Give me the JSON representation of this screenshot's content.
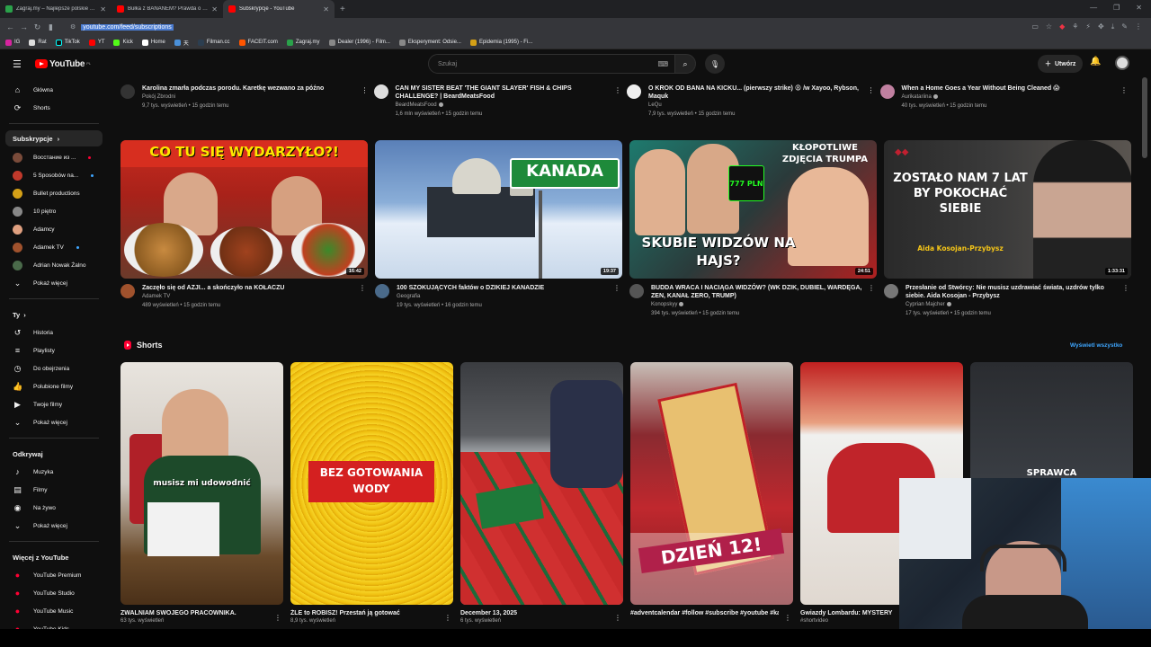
{
  "browser": {
    "tabs": [
      {
        "label": "Zagraj.my – Najlepsze polskie quizy",
        "color": "#2aa14a"
      },
      {
        "label": "Bułka z BANANEM? Prawda o Subsk",
        "color": "#ff0000"
      },
      {
        "label": "Subskrypcje - YouTube",
        "color": "#ff0000"
      }
    ],
    "new_tab": "+",
    "url": "youtube.com/feed/subscriptions",
    "bookmarks": [
      "IG",
      "Rat",
      "TikTok",
      "YT",
      "Kick",
      "Home",
      "天",
      "Filman.cc",
      "FACEIT.com",
      "Zagraj.my",
      "Dealer (1996) - Film...",
      "Eksperyment: Odsie...",
      "Epidemia (1995) - Fi..."
    ]
  },
  "header": {
    "logo": "YouTube",
    "country": "PL",
    "search_placeholder": "Szukaj",
    "create_label": "Utwórz"
  },
  "sidebar": {
    "main": [
      {
        "label": "Główna",
        "icon": "home-icon"
      },
      {
        "label": "Shorts",
        "icon": "shorts-icon"
      }
    ],
    "subs_header": "Subskrypcje",
    "channels": [
      {
        "label": "Восстание из ...",
        "color": "#7a4b3a",
        "live": true
      },
      {
        "label": "5 Sposobów na...",
        "color": "#c0392b",
        "live": false
      },
      {
        "label": "Bullet productions",
        "color": "#d4a017",
        "live": false
      },
      {
        "label": "10 piętro",
        "color": "#888888",
        "live": false
      },
      {
        "label": "Adamcy",
        "color": "#e0a080",
        "live": false
      },
      {
        "label": "Adamek TV",
        "color": "#a0522d",
        "live": true
      },
      {
        "label": "Adrian Nowak Żalno",
        "color": "#4a6a4a",
        "live": false
      }
    ],
    "show_more": "Pokaż więcej",
    "you_header": "Ty",
    "you": [
      {
        "label": "Historia",
        "icon": "history-icon"
      },
      {
        "label": "Playlisty",
        "icon": "playlist-icon"
      },
      {
        "label": "Do obejrzenia",
        "icon": "watch-later-icon"
      },
      {
        "label": "Polubione filmy",
        "icon": "like-icon"
      },
      {
        "label": "Twoje filmy",
        "icon": "your-videos-icon"
      }
    ],
    "explore_header": "Odkrywaj",
    "explore": [
      {
        "label": "Muzyka",
        "icon": "music-icon"
      },
      {
        "label": "Filmy",
        "icon": "film-icon"
      },
      {
        "label": "Na żywo",
        "icon": "live-icon"
      }
    ],
    "more_header": "Więcej z YouTube",
    "more": [
      {
        "label": "YouTube Premium"
      },
      {
        "label": "YouTube Studio"
      },
      {
        "label": "YouTube Music"
      },
      {
        "label": "YouTube Kids"
      }
    ]
  },
  "top_row": [
    {
      "title": "Karolina zmarła podczas porodu. Karetkę wezwano za późno",
      "channel": "Pokój Zbrodni",
      "stats": "9,7 tys. wyświetleń • 15 godzin temu",
      "ch_color": "#333333"
    },
    {
      "title": "CAN MY SISTER BEAT 'THE GIANT SLAYER' FISH & CHIPS CHALLENGE? | BeardMeatsFood",
      "channel": "BeardMeatsFood",
      "stats": "1,6 mln wyświetleń • 15 godzin temu",
      "ch_color": "#dddddd"
    },
    {
      "title": "O KROK OD BANA NA KICKU... (pierwszy strike) 😩 /w Xayoo, Rybson, Maquk",
      "channel": "LeQu",
      "stats": "7,9 tys. wyświetleń • 15 godzin temu",
      "ch_color": "#eeeeee"
    },
    {
      "title": "When a Home Goes a Year Without Being Cleaned 😱",
      "channel": "Aurikatariina",
      "stats": "40 tys. wyświetleń • 15 godzin temu",
      "ch_color": "#c080a0"
    }
  ],
  "videos": [
    {
      "title": "Zaczęło się od AZJI... a skończyło na KOŁACZU",
      "channel": "Adamek TV",
      "stats": "489 wyświetleń • 15 godzin temu",
      "duration": "16:42",
      "thumb_text": "CO TU SIĘ WYDARZYŁO?!",
      "ch_color": "#a0522d",
      "verified": false
    },
    {
      "title": "100 SZOKUJĄCYCH faktów o DZIKIEJ KANADZIE",
      "channel": "Geografia",
      "stats": "19 tys. wyświetleń • 16 godzin temu",
      "duration": "19:37",
      "thumb_text": "KANADA",
      "ch_color": "#4a6a8a",
      "verified": false
    },
    {
      "title": "BUDDA WRACA I NACIĄGA WIDZÓW? (WK DZIK, DUBIEL, WARDĘGA, ZEN, KANAŁ ZERO, TRUMP)",
      "channel": "Konopskyy",
      "stats": "394 tys. wyświetleń • 15 godzin temu",
      "duration": "24:51",
      "thumb_text": "SKUBIE WIDZÓW NA HAJS?",
      "thumb_top": "KŁOPOTLIWE ZDJĘCIA TRUMPA",
      "thumb_price": "777 PLN",
      "ch_color": "#555555",
      "verified": true
    },
    {
      "title": "Przesłanie od Stwórcy: Nie musisz uzdrawiać świata, uzdrów tylko siebie. Aida Kosojan - Przybysz",
      "channel": "Cyprian Majcher",
      "stats": "17 tys. wyświetleń • 15 godzin temu",
      "duration": "1:33:31",
      "thumb_text": "ZOSTAŁO NAM 7 LAT BY POKOCHAĆ SIEBIE",
      "thumb_name": "Aida Kosojan-Przybysz",
      "ch_color": "#777777",
      "verified": true
    }
  ],
  "shorts": {
    "title": "Shorts",
    "show_all": "Wyświetl wszystko",
    "items": [
      {
        "title": "ZWALNIAM SWOJEGO PRACOWNIKA.",
        "views": "63 tys. wyświetleń",
        "caption": "musisz mi udowodnić"
      },
      {
        "title": "ŹLE to ROBISZ! Przestań ją gotować",
        "views": "8,9 tys. wyświetleń",
        "caption": "BEZ GOTOWANIA WODY"
      },
      {
        "title": "December 13, 2025",
        "views": "6 tys. wyświetleń",
        "caption": ""
      },
      {
        "title": "#adventcalendar #follow #subscribe #youtube #kalendarzadwentowy ...",
        "views": "",
        "caption": "DZIEŃ 12!"
      },
      {
        "title": "Gwiazdy Lombardu: MYSTERY",
        "views": "#shortvideo",
        "caption": ""
      },
      {
        "title": "",
        "views": "",
        "caption": "SPRAWCA"
      }
    ]
  }
}
